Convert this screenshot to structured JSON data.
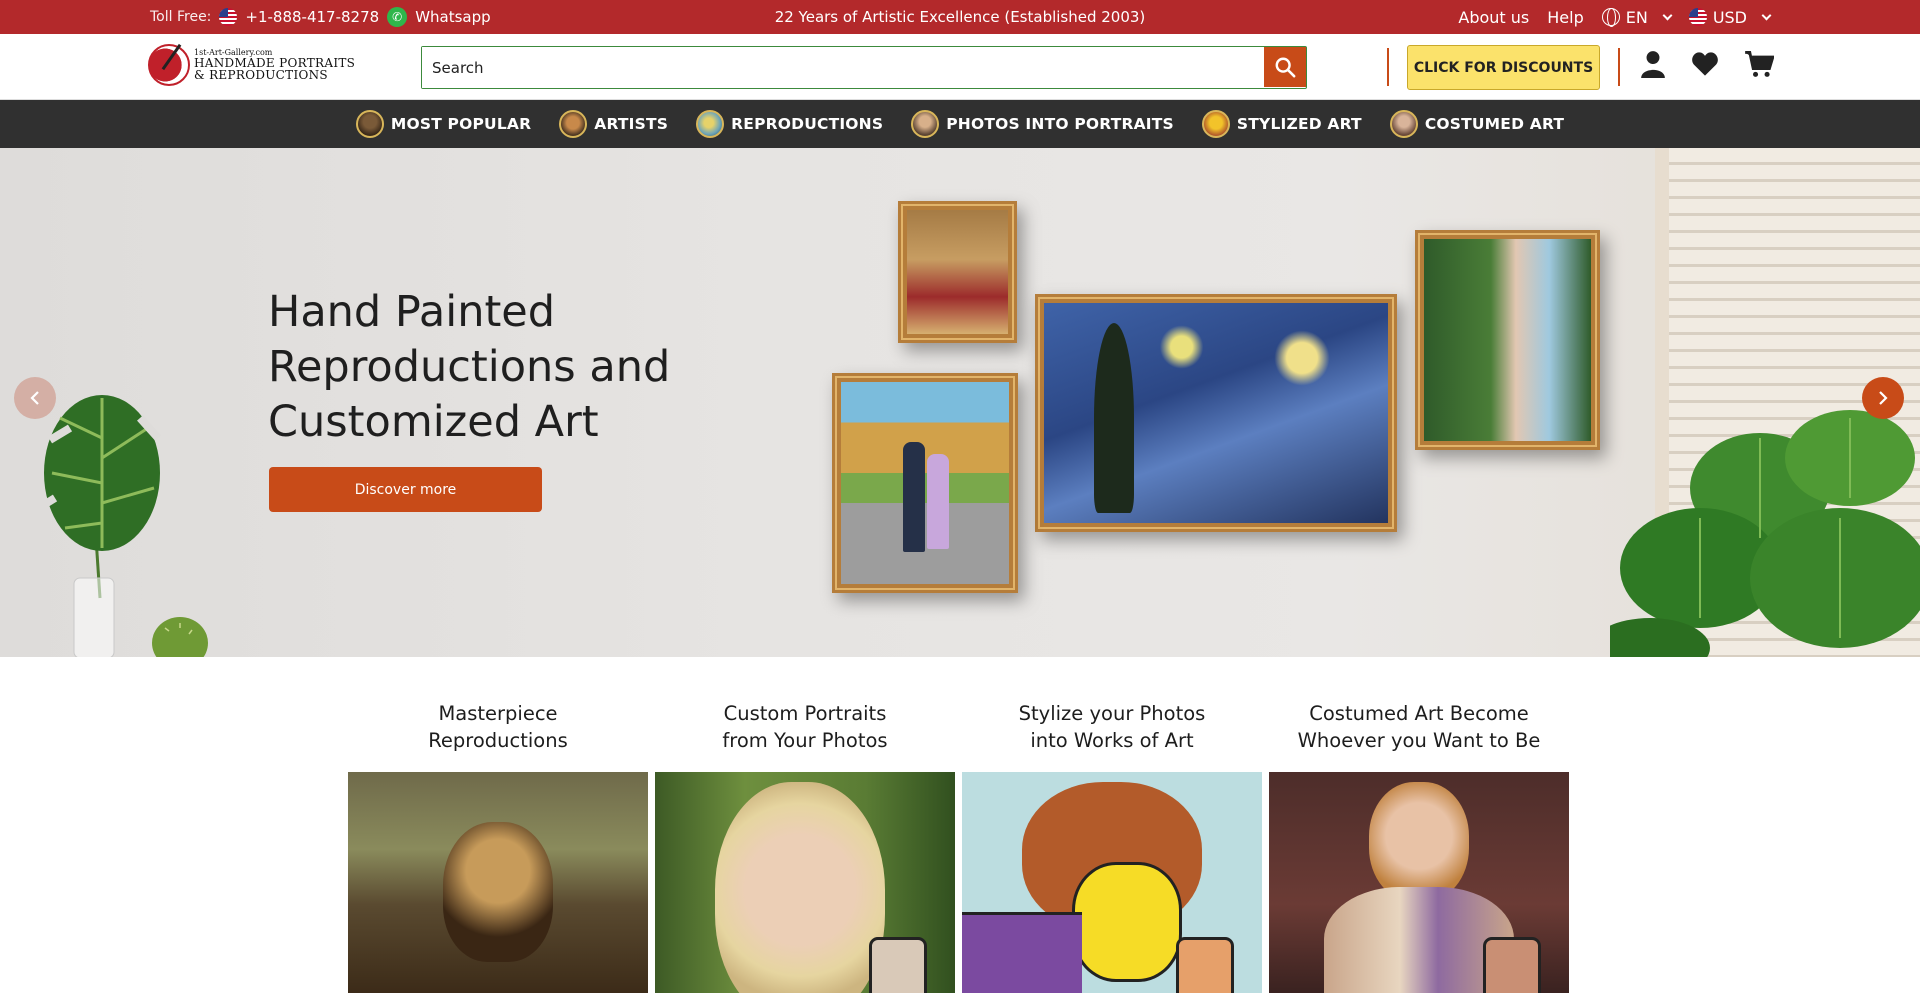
{
  "topbar": {
    "toll_free_label": "Toll Free:",
    "phone": "+1-888-417-8278",
    "whatsapp": "Whatsapp",
    "tagline": "22 Years of Artistic Excellence (Established 2003)",
    "about": "About us",
    "help": "Help",
    "language": "EN",
    "currency": "USD"
  },
  "header": {
    "logo_line1": "1st-Art-Gallery.com",
    "logo_line2": "HANDMADE PORTRAITS",
    "logo_line3": "& REPRODUCTIONS",
    "search_placeholder": "Search",
    "discounts_label": "CLICK FOR DISCOUNTS"
  },
  "nav": {
    "items": [
      {
        "label": "MOST POPULAR"
      },
      {
        "label": "ARTISTS"
      },
      {
        "label": "REPRODUCTIONS"
      },
      {
        "label": "PHOTOS INTO PORTRAITS"
      },
      {
        "label": "STYLIZED ART"
      },
      {
        "label": "COSTUMED ART"
      }
    ]
  },
  "hero": {
    "title": "Hand Painted Reproductions and Customized Art",
    "button": "Discover more"
  },
  "categories": [
    {
      "title": "Masterpiece\nReproductions"
    },
    {
      "title": "Custom Portraits\nfrom Your Photos"
    },
    {
      "title": "Stylize your Photos\ninto Works of Art"
    },
    {
      "title": "Costumed Art Become\nWhoever you Want to Be"
    }
  ],
  "colors": {
    "topbar_bg": "#b3292b",
    "accent": "#c84b18",
    "nav_bg": "#303030",
    "discount_bg": "#fbe26b"
  },
  "icons": [
    "us-flag-icon",
    "whatsapp-icon",
    "globe-icon",
    "chevron-down-icon",
    "search-icon",
    "user-icon",
    "heart-icon",
    "cart-icon",
    "chevron-left-icon",
    "chevron-right-icon"
  ]
}
